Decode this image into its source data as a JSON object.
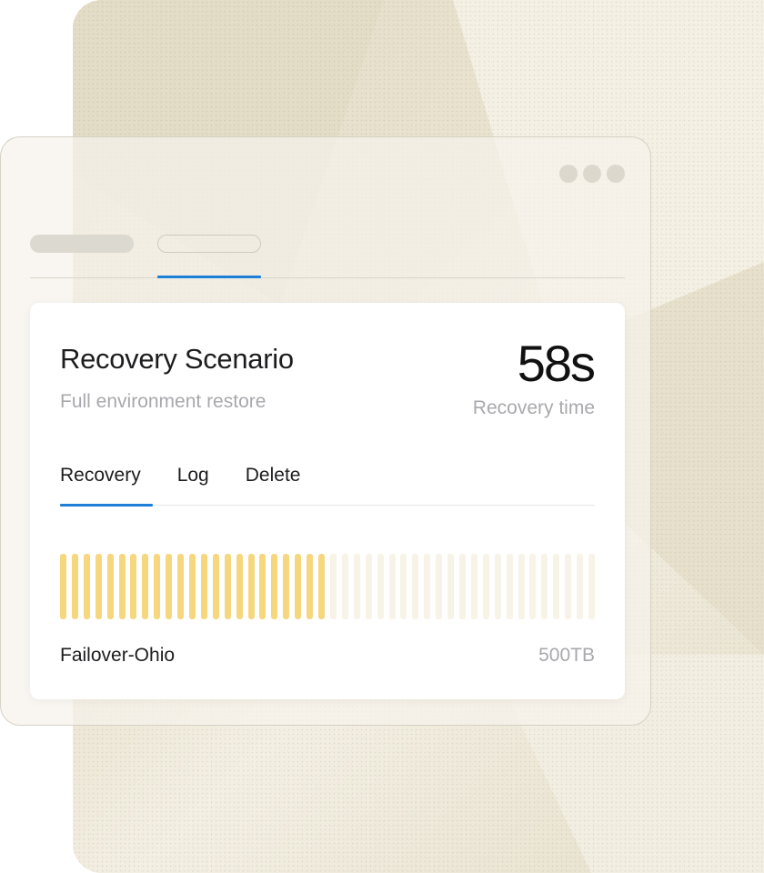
{
  "card": {
    "title": "Recovery Scenario",
    "subtitle": "Full environment restore",
    "metric_value": "58s",
    "metric_label": "Recovery time",
    "tabs": [
      {
        "label": "Recovery",
        "active": true
      },
      {
        "label": "Log",
        "active": false
      },
      {
        "label": "Delete",
        "active": false
      }
    ],
    "progress": {
      "filled_segments": 23,
      "total_segments": 46,
      "fraction": 0.5
    },
    "footer_name": "Failover-Ohio",
    "footer_size": "500TB"
  },
  "colors": {
    "accent": "#1e7fd9",
    "bar_filled": "#f6d77e",
    "bar_empty": "#f7f3e6",
    "backdrop": "#efe9d8"
  }
}
